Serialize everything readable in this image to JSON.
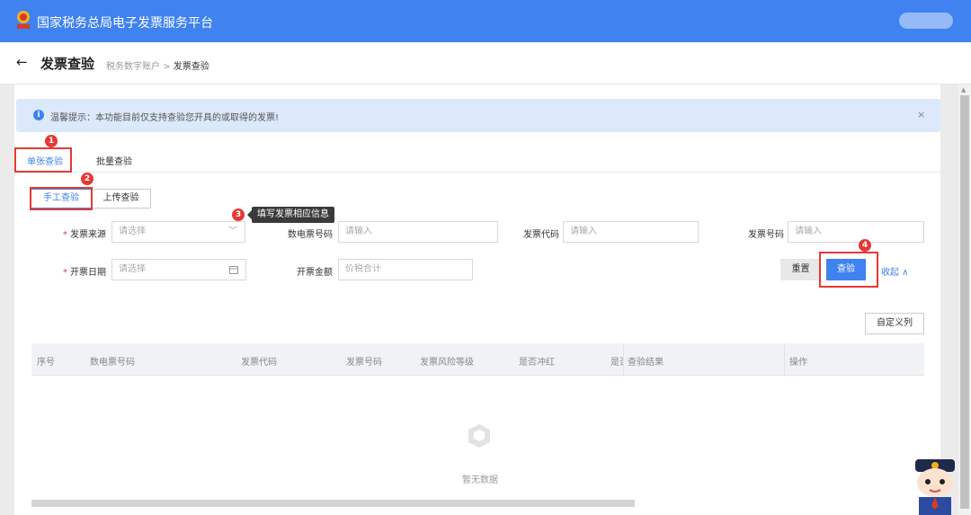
{
  "app": {
    "title": "国家税务总局电子发票服务平台"
  },
  "page": {
    "back_arrow": "←",
    "title": "发票查验",
    "breadcrumb": {
      "parent": "税务数字账户",
      "separator": ">",
      "current": "发票查验"
    }
  },
  "notice": {
    "text": "温馨提示：本功能目前仅支持查验您开具的或取得的发票!",
    "close": "×"
  },
  "tabs": [
    "单张查验",
    "批量查验"
  ],
  "subtabs": [
    "手工查验",
    "上传查验"
  ],
  "form": {
    "source_label": "发票来源",
    "source_placeholder": "请选择",
    "source_arrow": "﹀",
    "digital_no_label": "数电票号码",
    "digital_no_placeholder": "请输入",
    "code_label": "发票代码",
    "code_placeholder": "请输入",
    "number_label": "发票号码",
    "number_placeholder": "请输入",
    "date_label": "开票日期",
    "date_placeholder": "请选择",
    "amount_label": "开票金额",
    "amount_placeholder": "价税合计",
    "required_mark": "*"
  },
  "actions": {
    "reset": "重置",
    "query": "查验",
    "collapse": "收起 ∧",
    "custom_columns": "自定义列"
  },
  "table": {
    "columns": [
      "序号",
      "数电票号码",
      "发票代码",
      "发票号码",
      "发票风险等级",
      "是否冲红",
      "是否",
      "查验结果",
      "操作"
    ],
    "empty": "暂无数据"
  },
  "annotations": {
    "badges": [
      "1",
      "2",
      "3",
      "4"
    ],
    "tooltip": "填写发票相应信息"
  },
  "colors": {
    "primary": "#3f82f0",
    "highlight": "#e53935"
  }
}
